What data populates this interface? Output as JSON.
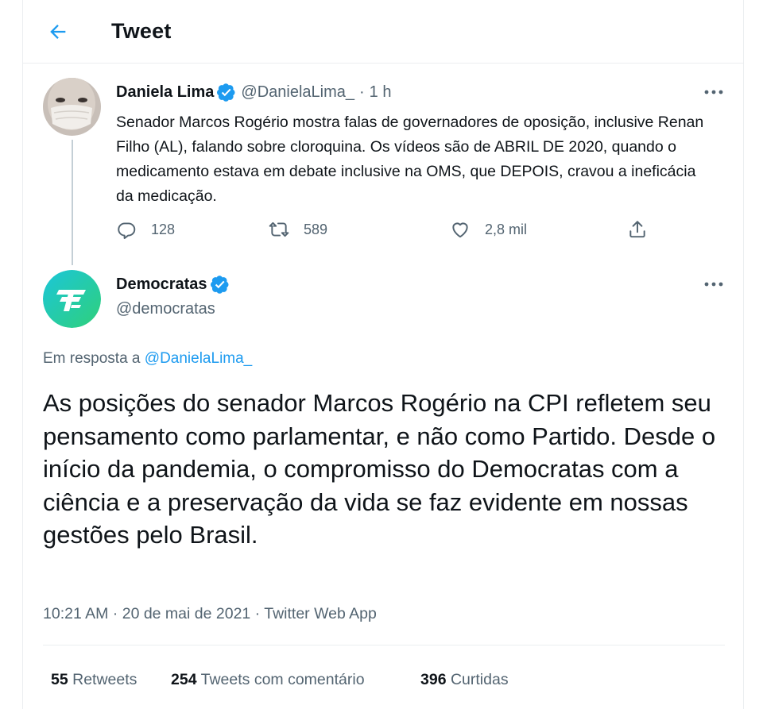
{
  "header": {
    "title": "Tweet",
    "back_icon": "arrow-left-icon"
  },
  "accent_color": "#1d9bf0",
  "quoted_tweet": {
    "author_name": "Daniela Lima",
    "verified": true,
    "handle": "@DanielaLima_",
    "separator": "·",
    "time": "1 h",
    "text": "Senador Marcos Rogério mostra falas de governadores de oposição, inclusive Renan Filho (AL), falando sobre cloroquina. Os vídeos são de ABRIL DE 2020, quando o medicamento estava em debate inclusive na OMS, que DEPOIS, cravou a ineficácia da medicação.",
    "actions": {
      "replies": "128",
      "retweets": "589",
      "likes": "2,8 mil"
    }
  },
  "main_tweet": {
    "author_name": "Democratas",
    "verified": true,
    "handle": "@democratas",
    "reply_prefix": "Em resposta a",
    "reply_handle": "@DanielaLima_",
    "text": "As posições do senador Marcos Rogério na CPI refletem seu pensamento como parlamentar, e não como Partido. Desde o início da pandemia, o compromisso do Democratas com a ciência e a preservação da vida se faz evidente em nossas gestões pelo Brasil.",
    "meta": "10:21 AM · 20 de mai de 2021 · Twitter Web App",
    "stats": {
      "retweets_count": "55",
      "retweets_label": "Retweets",
      "quotes_count": "254",
      "quotes_label": "Tweets com comentário",
      "likes_count": "396",
      "likes_label": "Curtidas"
    }
  }
}
